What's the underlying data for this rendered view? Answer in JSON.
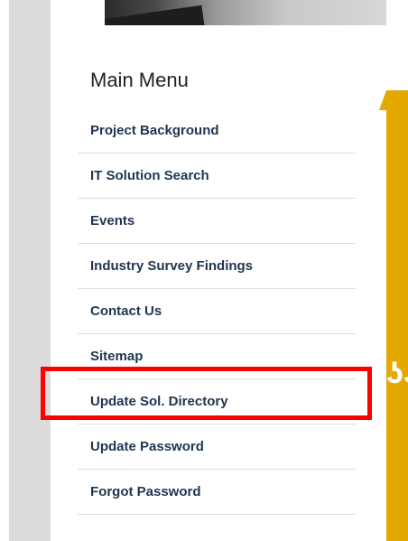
{
  "menu": {
    "title": "Main Menu",
    "items": [
      {
        "label": "Project Background"
      },
      {
        "label": "IT Solution Search"
      },
      {
        "label": "Events"
      },
      {
        "label": "Industry Survey Findings"
      },
      {
        "label": "Contact Us"
      },
      {
        "label": "Sitemap"
      },
      {
        "label": "Update Sol. Directory"
      },
      {
        "label": "Update Password"
      },
      {
        "label": "Forgot Password"
      }
    ]
  },
  "colors": {
    "accent": "#e4a900",
    "highlight": "#ff0000",
    "link": "#1e3550"
  }
}
